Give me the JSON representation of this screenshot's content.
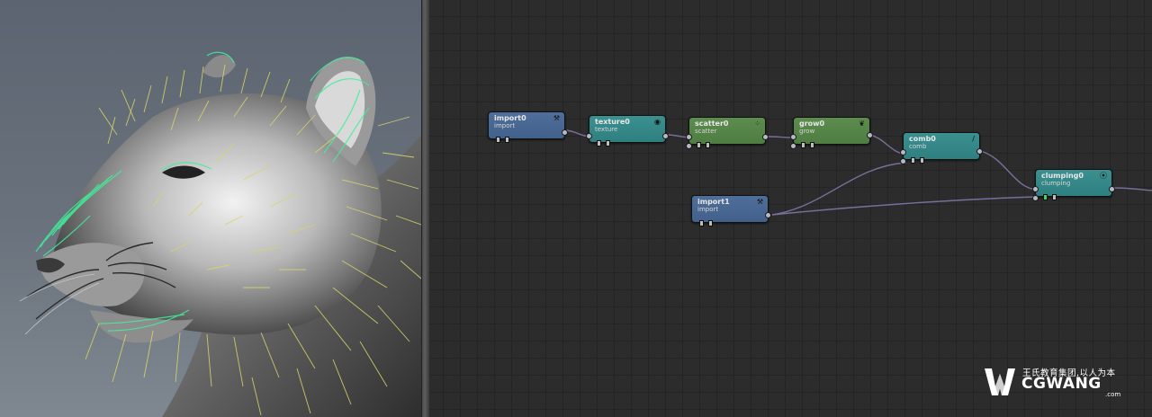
{
  "nodes": [
    {
      "id": "import0",
      "title": "import0",
      "sub": "import",
      "color": "#4a6b96",
      "glyph": "⚒"
    },
    {
      "id": "texture0",
      "title": "texture0",
      "sub": "texture",
      "color": "#368a8b",
      "glyph": "◉"
    },
    {
      "id": "scatter0",
      "title": "scatter0",
      "sub": "scatter",
      "color": "#578849",
      "glyph": "⁘"
    },
    {
      "id": "grow0",
      "title": "grow0",
      "sub": "grow",
      "color": "#578849",
      "glyph": "❦"
    },
    {
      "id": "comb0",
      "title": "comb0",
      "sub": "comb",
      "color": "#368a8b",
      "glyph": "/"
    },
    {
      "id": "import1",
      "title": "import1",
      "sub": "import",
      "color": "#4a6b96",
      "glyph": "⚒"
    },
    {
      "id": "clumping0",
      "title": "clumping0",
      "sub": "clumping",
      "color": "#368a8b",
      "glyph": "⦿"
    }
  ],
  "colors": {
    "hair_yellow": "#d8d46a",
    "hair_green": "#3ff09a",
    "wire": "#7a6f9c",
    "active_indicator": "#3fd85a"
  },
  "watermark": {
    "cn": "王氏教育集团,以人为本",
    "en": "CGWANG",
    "domain": ".com"
  }
}
